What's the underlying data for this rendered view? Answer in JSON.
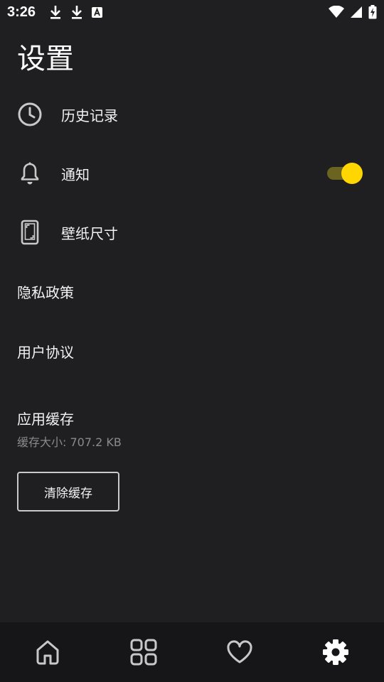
{
  "status_bar": {
    "time": "3:26",
    "left_icons": [
      "download-icon",
      "download-icon",
      "font-a-icon"
    ],
    "right_icons": [
      "wifi-icon",
      "signal-icon",
      "battery-charging-icon"
    ]
  },
  "page": {
    "title": "设置"
  },
  "settings": {
    "history": {
      "label": "历史记录",
      "icon": "clock-icon"
    },
    "notification": {
      "label": "通知",
      "icon": "bell-icon",
      "enabled": true
    },
    "wallpaper_size": {
      "label": "壁纸尺寸",
      "icon": "phone-frame-icon"
    },
    "privacy": {
      "label": "隐私政策"
    },
    "agreement": {
      "label": "用户协议"
    }
  },
  "cache": {
    "title": "应用缓存",
    "size_text": "缓存大小: 707.2 KB",
    "clear_label": "清除缓存"
  },
  "bottom_nav": {
    "items": [
      "home-icon",
      "grid-icon",
      "heart-icon",
      "gear-icon"
    ],
    "active": "gear-icon"
  },
  "colors": {
    "background": "#1f1f21",
    "nav_background": "#161618",
    "accent": "#ffd600",
    "toggle_track": "#6b6420",
    "secondary_text": "#8a8a8c"
  }
}
